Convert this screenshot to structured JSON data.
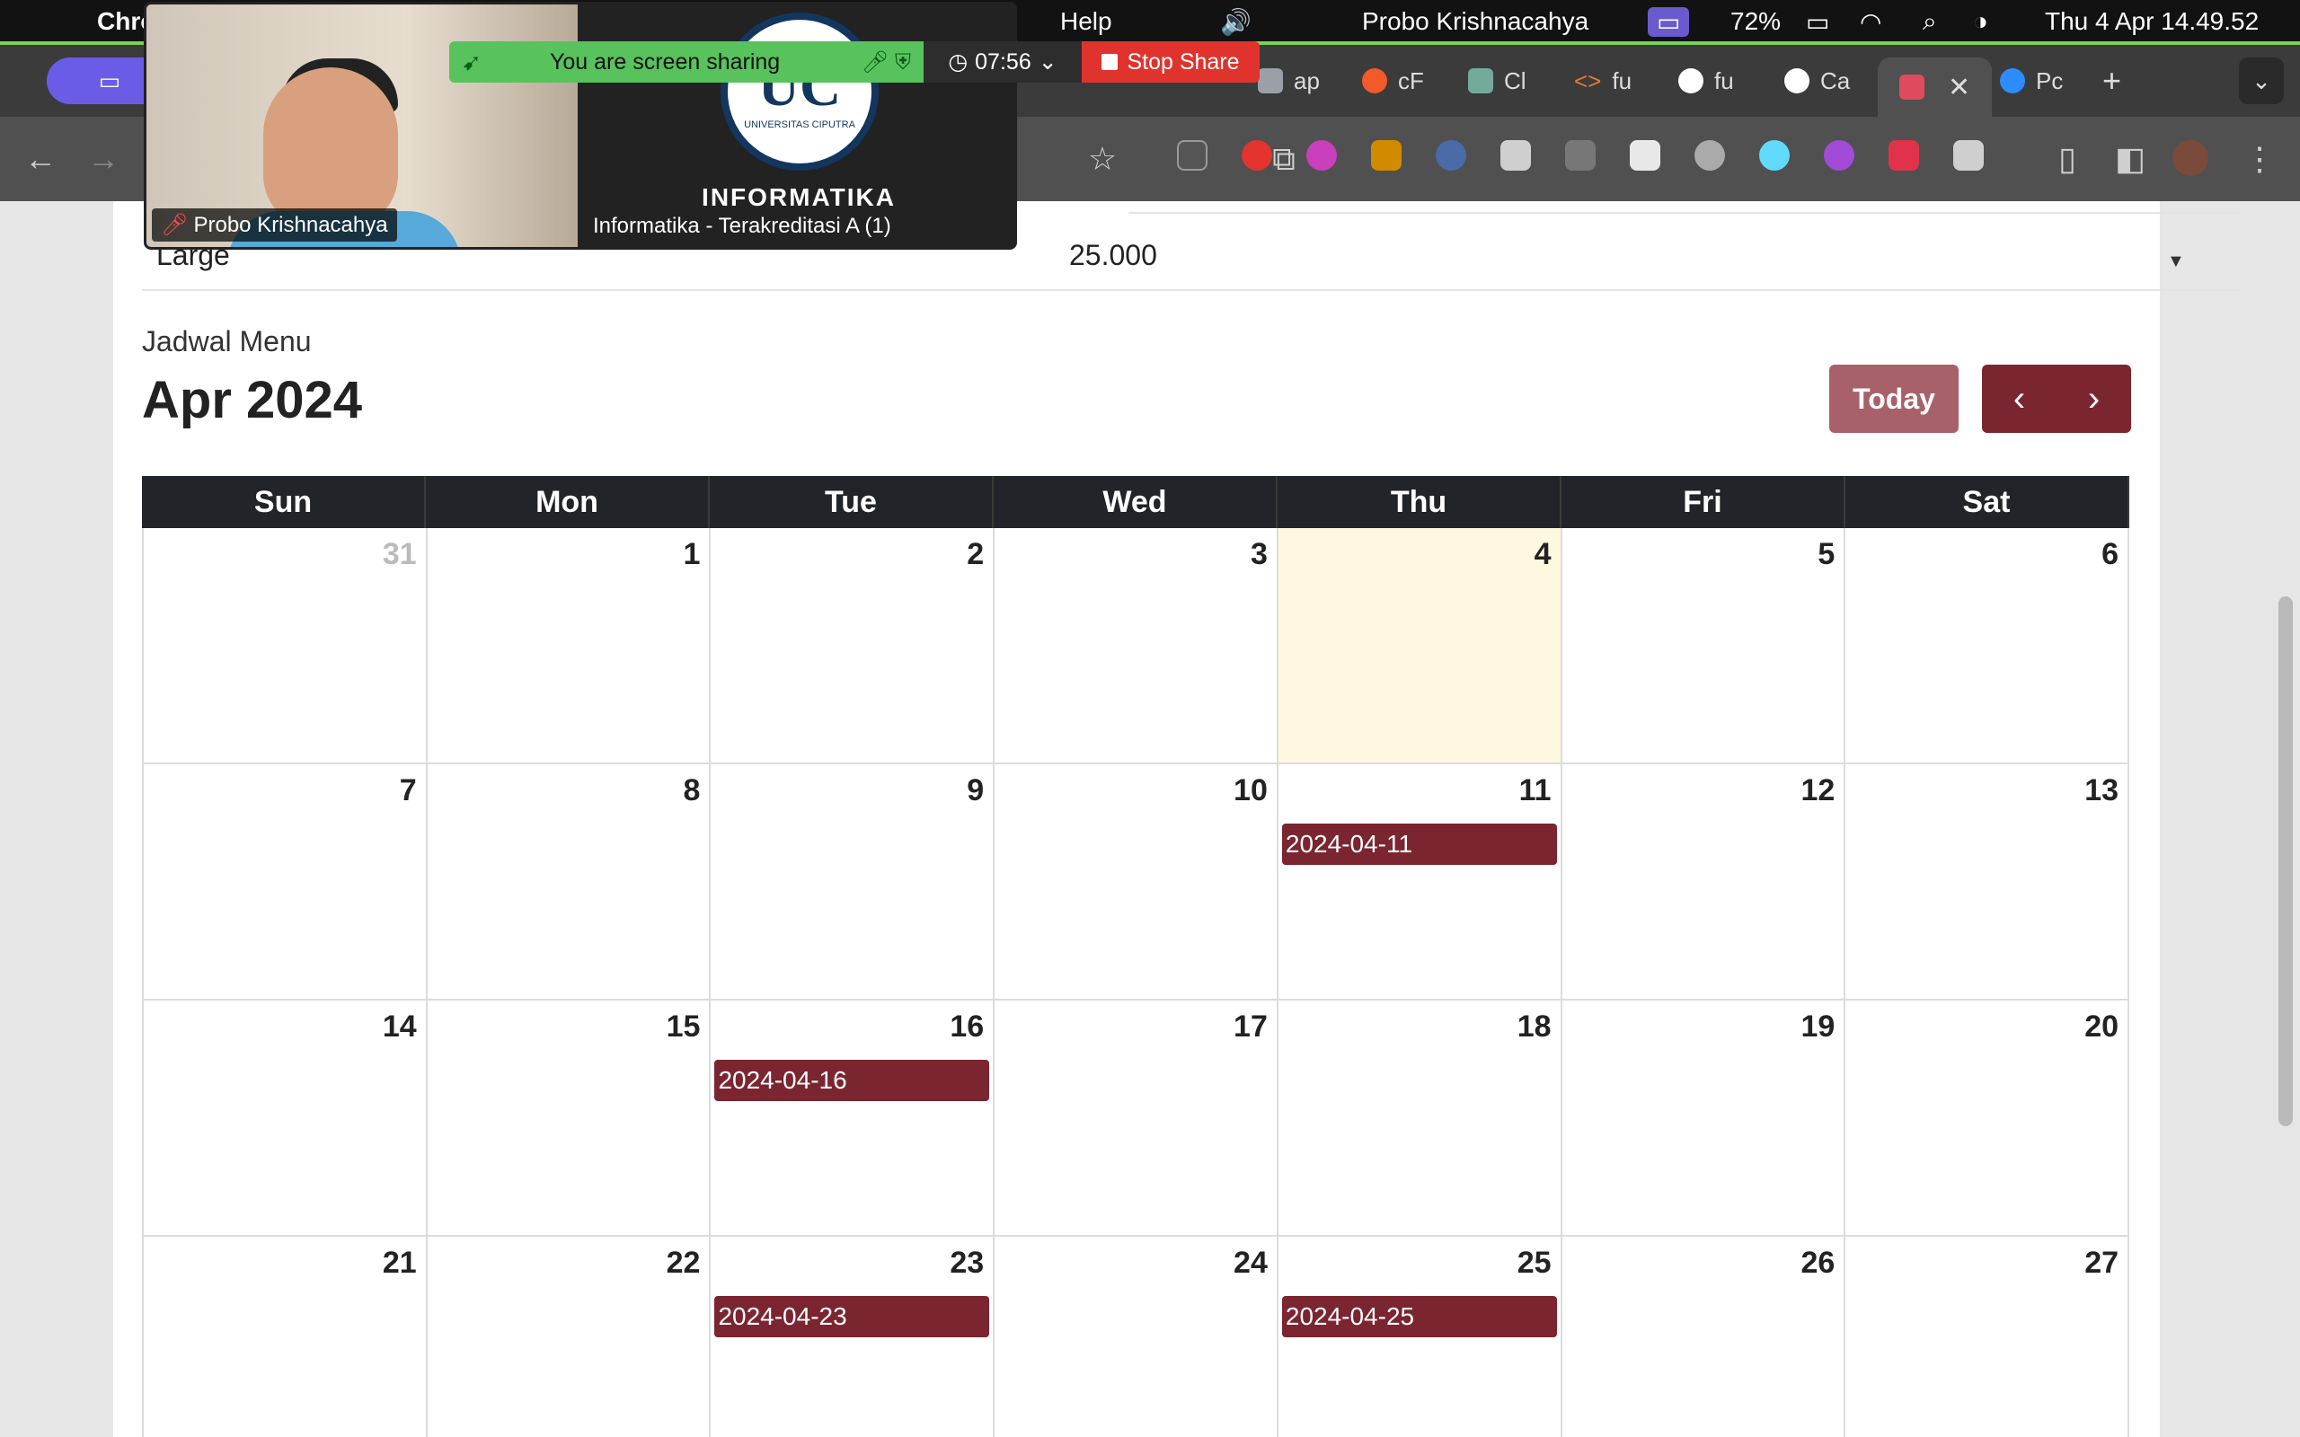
{
  "menubar": {
    "app_name": "Chrome",
    "help": "Help",
    "user": "Probo Krishnacahya",
    "battery": "72%",
    "datetime": "Thu 4 Apr  14.49.52"
  },
  "zoom": {
    "sharing_text": "You are screen sharing",
    "timer": "07:56",
    "stop_label": "Stop Share",
    "participant_name": "Probo Krishnacahya",
    "share_title": "INFORMATIKA",
    "share_label": "Informatika - Terakreditasi A (1)",
    "seal_text": "UC",
    "seal_sub": "UNIVERSITAS CIPUTRA"
  },
  "tabs": [
    {
      "label": "ap",
      "color": "#9aa0a6"
    },
    {
      "label": "cF",
      "color": "#f25a29"
    },
    {
      "label": "Cl",
      "color": "#74aa9c"
    },
    {
      "label": "fu",
      "color": "#e07b39"
    },
    {
      "label": "fu",
      "color": "#ffffff"
    },
    {
      "label": "Ca",
      "color": "#ffffff"
    },
    {
      "label": "",
      "color": "#e04a5f"
    },
    {
      "label": "Pc",
      "color": "#2d8cff"
    }
  ],
  "page": {
    "prev_size": "Large",
    "prev_price": "25.000",
    "subtitle": "Jadwal Menu",
    "month": "Apr 2024",
    "today_label": "Today",
    "prev_icon": "‹",
    "next_icon": "›"
  },
  "calendar": {
    "weekdays": [
      "Sun",
      "Mon",
      "Tue",
      "Wed",
      "Thu",
      "Fri",
      "Sat"
    ],
    "weeks": [
      [
        {
          "d": "31",
          "other": true
        },
        {
          "d": "1"
        },
        {
          "d": "2"
        },
        {
          "d": "3"
        },
        {
          "d": "4",
          "today": true
        },
        {
          "d": "5"
        },
        {
          "d": "6"
        }
      ],
      [
        {
          "d": "7"
        },
        {
          "d": "8"
        },
        {
          "d": "9"
        },
        {
          "d": "10"
        },
        {
          "d": "11",
          "event": "2024-04-11"
        },
        {
          "d": "12"
        },
        {
          "d": "13"
        }
      ],
      [
        {
          "d": "14"
        },
        {
          "d": "15"
        },
        {
          "d": "16",
          "event": "2024-04-16"
        },
        {
          "d": "17"
        },
        {
          "d": "18"
        },
        {
          "d": "19"
        },
        {
          "d": "20"
        }
      ],
      [
        {
          "d": "21"
        },
        {
          "d": "22"
        },
        {
          "d": "23",
          "event": "2024-04-23"
        },
        {
          "d": "24"
        },
        {
          "d": "25",
          "event": "2024-04-25"
        },
        {
          "d": "26"
        },
        {
          "d": "27"
        }
      ]
    ]
  }
}
